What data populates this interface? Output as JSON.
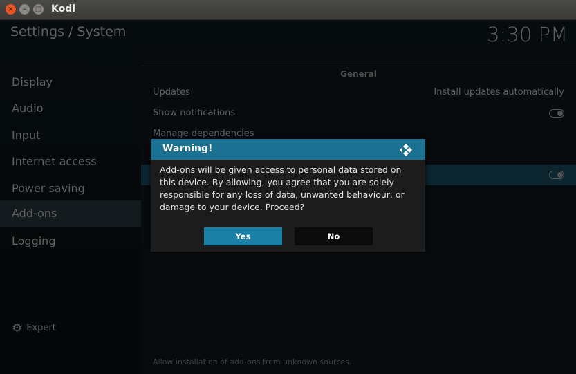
{
  "window": {
    "title": "Kodi"
  },
  "header": {
    "breadcrumb": "Settings / System",
    "clock": "3:30 PM"
  },
  "sidebar": {
    "items": [
      {
        "label": "Display"
      },
      {
        "label": "Audio"
      },
      {
        "label": "Input"
      },
      {
        "label": "Internet access"
      },
      {
        "label": "Power saving"
      },
      {
        "label": "Add-ons",
        "selected": true
      },
      {
        "label": "Logging"
      }
    ],
    "expert_label": "Expert"
  },
  "content": {
    "group_label": "General",
    "rows": [
      {
        "label": "Updates",
        "value": "Install updates automatically"
      },
      {
        "label": "Show notifications",
        "toggle": "off"
      },
      {
        "label": "Manage dependencies"
      }
    ],
    "footer_description": "Allow installation of add-ons from unknown sources."
  },
  "dialog": {
    "title": "Warning!",
    "message": "Add-ons will be given access to personal data stored on this device. By allowing, you agree that you are solely responsible for any loss of data, unwanted behaviour, or damage to your device. Proceed?",
    "yes_label": "Yes",
    "no_label": "No",
    "colors": {
      "header": "#1a7192",
      "yes_button": "#1a80a6"
    }
  }
}
